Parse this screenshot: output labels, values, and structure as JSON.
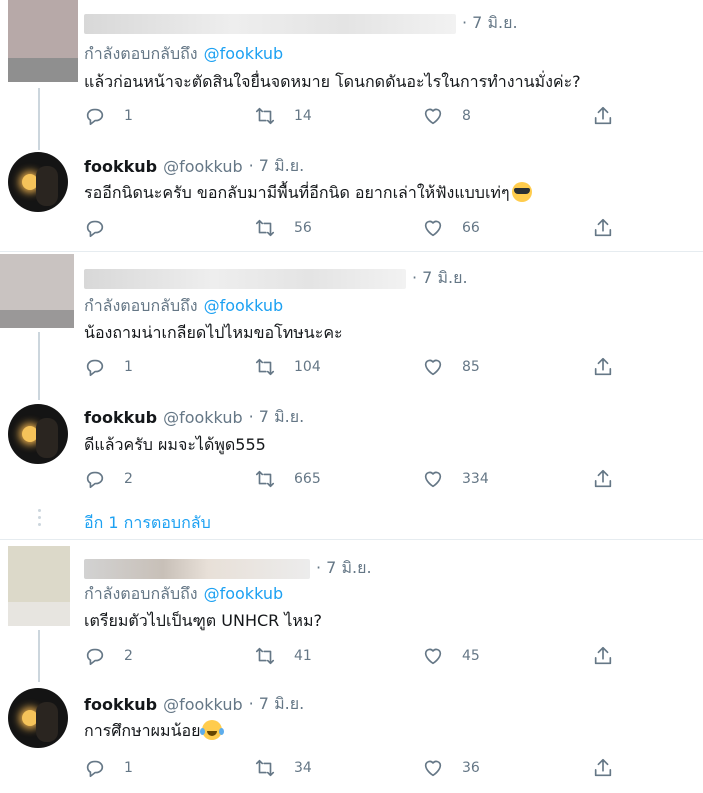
{
  "replying_label": "กำลังตอบกลับถึง",
  "show_more": "อีก 1 การตอบกลับ",
  "colors": {
    "link": "#1da1f2",
    "muted": "#657786",
    "text": "#14171a"
  },
  "icons": {
    "reply": "reply-icon",
    "retweet": "retweet-icon",
    "like": "like-icon",
    "share": "share-icon"
  },
  "threads": [
    {
      "question": {
        "date": "· 7 มิ.ย.",
        "mention": "@fookkub",
        "text": "แล้วก่อนหน้าจะตัดสินใจยื่นจดหมาย โดนกดดันอะไรในการทำงานมั่งค่ะ?",
        "replies": "1",
        "retweets": "14",
        "likes": "8"
      },
      "answer": {
        "name": "fookkub",
        "handle": "@fookkub",
        "date": "· 7 มิ.ย.",
        "text": "รออีกนิดนะครับ ขอกลับมามีพื้นที่อีกนิด อยากเล่าให้ฟังแบบเท่ๆ",
        "emoji": "sunglasses-emoji",
        "replies": "",
        "retweets": "56",
        "likes": "66"
      }
    },
    {
      "question": {
        "date": "· 7 มิ.ย.",
        "mention": "@fookkub",
        "text": "น้องถามน่าเกลียดไปไหมขอโทษนะคะ",
        "replies": "1",
        "retweets": "104",
        "likes": "85"
      },
      "answer": {
        "name": "fookkub",
        "handle": "@fookkub",
        "date": "· 7 มิ.ย.",
        "text": "ดีแล้วครับ ผมจะได้พูด555",
        "emoji": "",
        "replies": "2",
        "retweets": "665",
        "likes": "334"
      }
    },
    {
      "question": {
        "date": "· 7 มิ.ย.",
        "mention": "@fookkub",
        "text": "เตรียมตัวไปเป็นฑูต UNHCR ไหม?",
        "replies": "2",
        "retweets": "41",
        "likes": "45"
      },
      "answer": {
        "name": "fookkub",
        "handle": "@fookkub",
        "date": "· 7 มิ.ย.",
        "text": "การศึกษาผมน้อย",
        "emoji": "laughing-tears-emoji",
        "replies": "1",
        "retweets": "34",
        "likes": "36"
      }
    }
  ]
}
